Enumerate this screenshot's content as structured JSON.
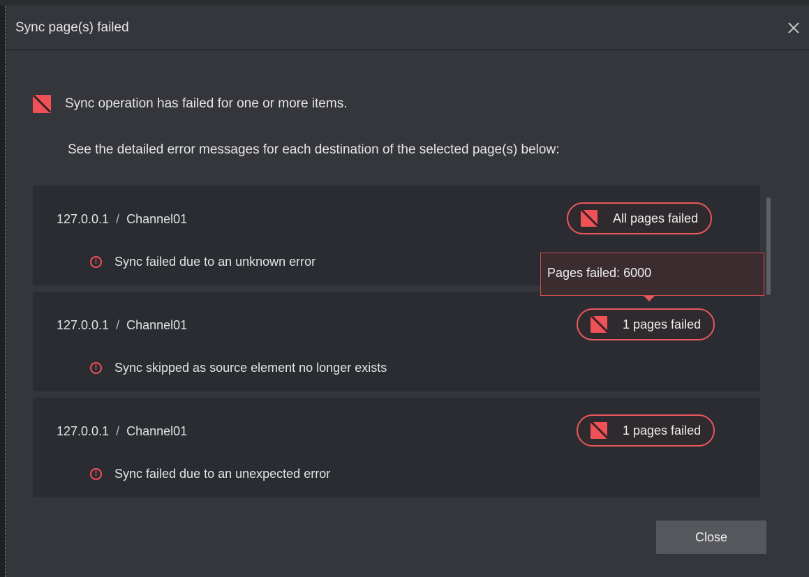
{
  "dialog": {
    "title": "Sync page(s) failed",
    "summary": "Sync operation has failed for one or more items.",
    "detail": "See the detailed error messages for each destination of the selected page(s) below:",
    "close_button": "Close"
  },
  "items": [
    {
      "host": "127.0.0.1",
      "separator": "/",
      "channel": "Channel01",
      "badge": "All pages failed",
      "message": "Sync failed due to an unknown error"
    },
    {
      "host": "127.0.0.1",
      "separator": "/",
      "channel": "Channel01",
      "badge": "1 pages failed",
      "message": "Sync skipped as source element no longer exists"
    },
    {
      "host": "127.0.0.1",
      "separator": "/",
      "channel": "Channel01",
      "badge": "1 pages failed",
      "message": "Sync failed due to an unexpected error"
    }
  ],
  "tooltip": {
    "text": "Pages failed: 6000"
  },
  "icons": {
    "close": "close-icon",
    "error": "error-square-icon",
    "warning": "exclamation-circle-icon"
  },
  "colors": {
    "accent_error": "#ef5157",
    "background": "#34363b",
    "card": "#2a2c31"
  }
}
